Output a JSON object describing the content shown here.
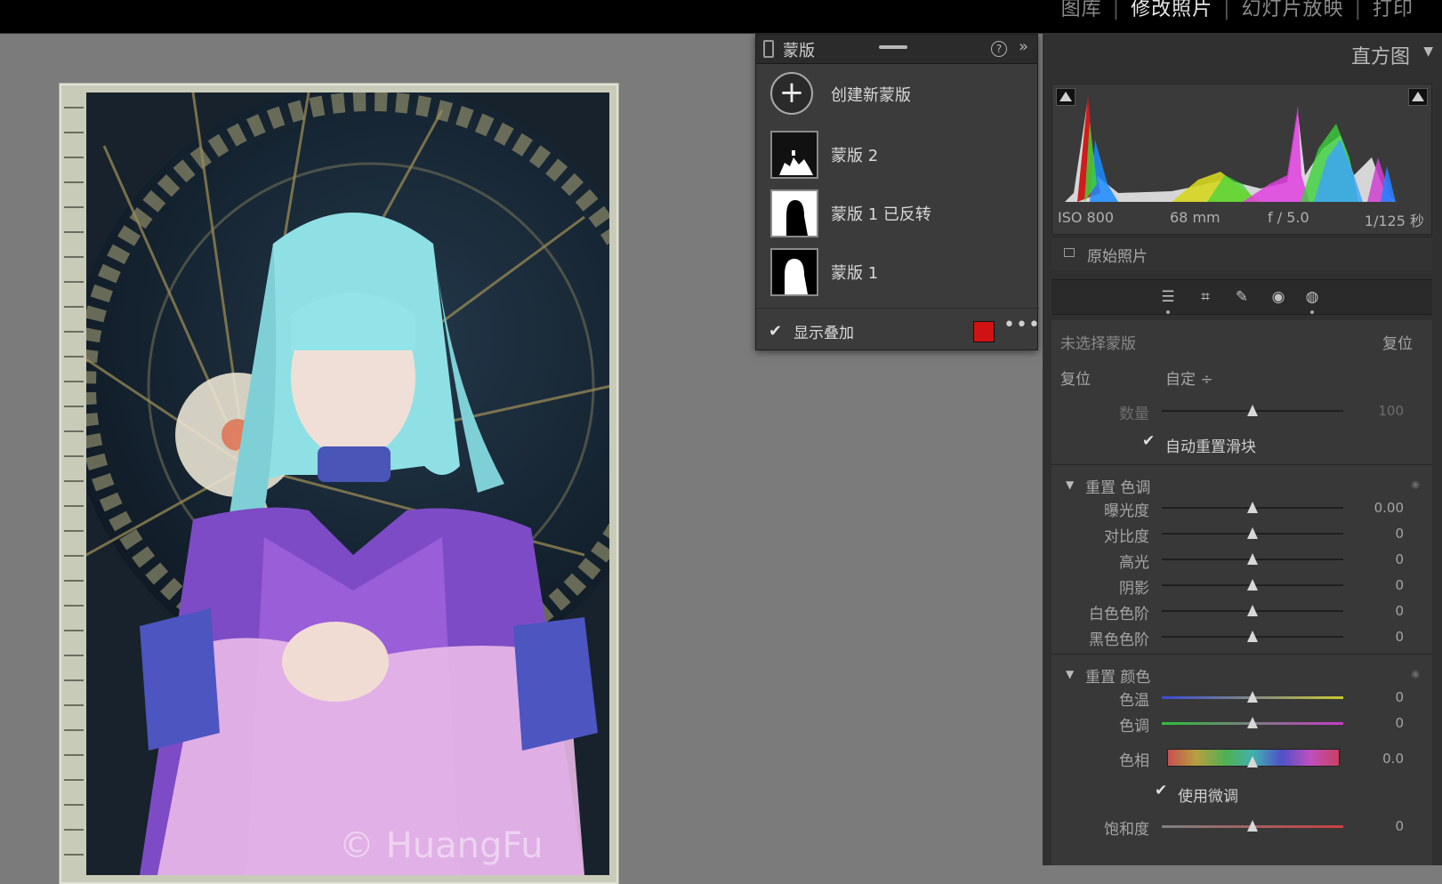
{
  "modules": {
    "library": "图库",
    "develop": "修改照片",
    "slideshow": "幻灯片放映",
    "print": "打印",
    "sep": "|"
  },
  "photo": {
    "watermark": "© HuangFu"
  },
  "mask_panel": {
    "title": "蒙版",
    "help": "?",
    "collapse": "»",
    "create_label": "创建新蒙版",
    "create_symbol": "+",
    "masks": [
      {
        "label": "蒙版 2"
      },
      {
        "label": "蒙版 1 已反转"
      },
      {
        "label": "蒙版 1"
      }
    ],
    "show_overlay_label": "显示叠加",
    "show_overlay_checked": true,
    "overlay_color": "#d01212",
    "more": "•••"
  },
  "histogram": {
    "title": "直方图",
    "arrow": "▼",
    "iso": "ISO 800",
    "focal": "68 mm",
    "aperture": "f / 5.0",
    "shutter": "1/125 秒",
    "original_photo_label": "原始照片"
  },
  "tools": [
    "sliders-icon",
    "crop-icon",
    "heal-icon",
    "redeye-icon",
    "mask-icon"
  ],
  "adjust": {
    "no_mask": "未选择蒙版",
    "reset_top": "复位",
    "reset_label": "复位",
    "preset": "自定 ÷",
    "amount_label": "数量",
    "amount_value": "100",
    "auto_reset_label": "自动重置滑块",
    "tone_section": "重置 色调",
    "tone": [
      {
        "label": "曝光度",
        "value": "0.00"
      },
      {
        "label": "对比度",
        "value": "0"
      },
      {
        "label": "高光",
        "value": "0"
      },
      {
        "label": "阴影",
        "value": "0"
      },
      {
        "label": "白色色阶",
        "value": "0"
      },
      {
        "label": "黑色色阶",
        "value": "0"
      }
    ],
    "color_section": "重置 颜色",
    "temp_label": "色温",
    "temp_value": "0",
    "tint_label": "色调",
    "tint_value": "0",
    "hue_label": "色相",
    "hue_value": "0.0",
    "fine_label": "使用微调",
    "sat_label": "饱和度",
    "sat_value": "0"
  }
}
